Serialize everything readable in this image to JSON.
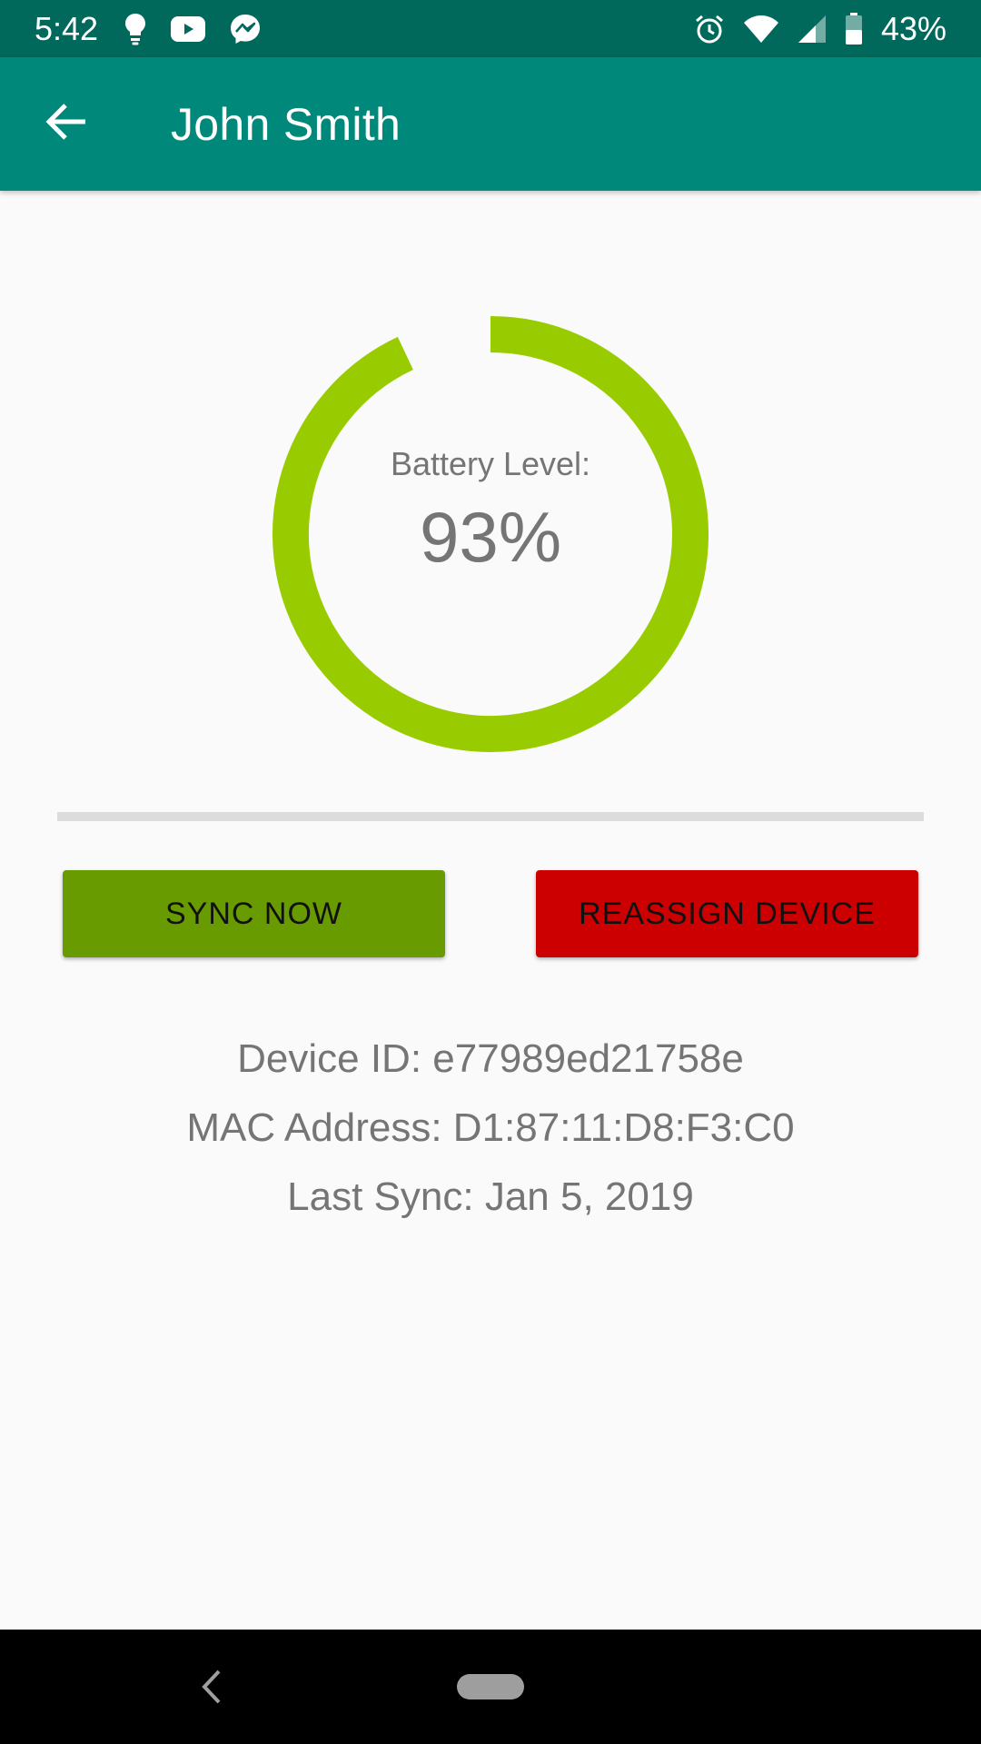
{
  "status_bar": {
    "time": "5:42",
    "battery_percent": "43%",
    "icons": [
      "lightbulb-icon",
      "youtube-icon",
      "messenger-icon",
      "alarm-icon",
      "wifi-icon",
      "signal-icon",
      "battery-icon"
    ]
  },
  "app_bar": {
    "title": "John Smith",
    "back_icon": "arrow-back-icon"
  },
  "battery_gauge": {
    "label": "Battery Level:",
    "value_text": "93%",
    "level_fraction": 0.93,
    "color": "#99cc00"
  },
  "actions": {
    "sync_label": "SYNC NOW",
    "reassign_label": "REASSIGN DEVICE",
    "sync_color": "#689b00",
    "reassign_color": "#cc0000"
  },
  "device_info": {
    "device_id": "Device ID: e77989ed21758e",
    "mac_address": "MAC Address: D1:87:11:D8:F3:C0",
    "last_sync": "Last Sync: Jan 5, 2019"
  },
  "colors": {
    "status_bar": "#00695c",
    "app_bar": "#00897b",
    "text_secondary": "#757575"
  }
}
